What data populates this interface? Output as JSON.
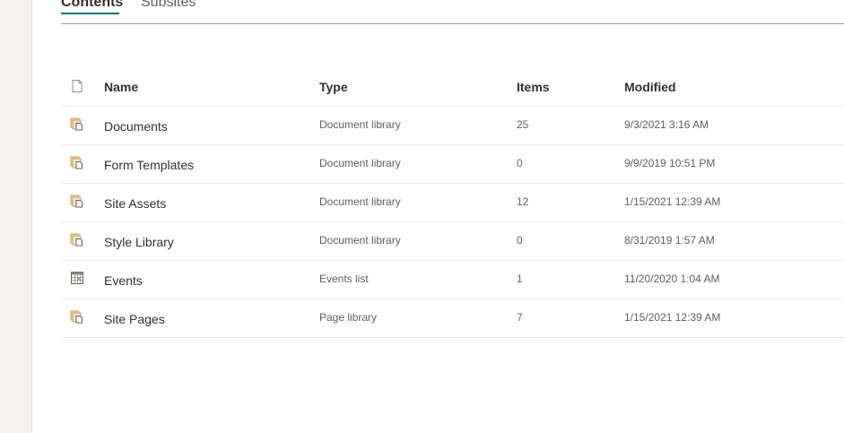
{
  "pivot": {
    "tabs": [
      {
        "label": "Contents",
        "selected": true
      },
      {
        "label": "Subsites",
        "selected": false
      }
    ]
  },
  "table": {
    "columns": {
      "icon": "file-type-icon",
      "name": "Name",
      "type": "Type",
      "items": "Items",
      "modified": "Modified"
    },
    "rows": [
      {
        "icon": "document-library-icon",
        "name": "Documents",
        "type": "Document library",
        "items": "25",
        "modified": "9/3/2021 3:16 AM"
      },
      {
        "icon": "document-library-icon",
        "name": "Form Templates",
        "type": "Document library",
        "items": "0",
        "modified": "9/9/2019 10:51 PM"
      },
      {
        "icon": "document-library-icon",
        "name": "Site Assets",
        "type": "Document library",
        "items": "12",
        "modified": "1/15/2021 12:39 AM"
      },
      {
        "icon": "document-library-icon",
        "name": "Style Library",
        "type": "Document library",
        "items": "0",
        "modified": "8/31/2019 1:57 AM"
      },
      {
        "icon": "events-calendar-icon",
        "name": "Events",
        "type": "Events list",
        "items": "1",
        "modified": "11/20/2020 1:04 AM"
      },
      {
        "icon": "document-library-icon",
        "name": "Site Pages",
        "type": "Page library",
        "items": "7",
        "modified": "1/15/2021 12:39 AM"
      }
    ]
  },
  "colors": {
    "accent": "#03787c",
    "library_icon": "#c8a15a",
    "rail": "#f3f2f1"
  }
}
